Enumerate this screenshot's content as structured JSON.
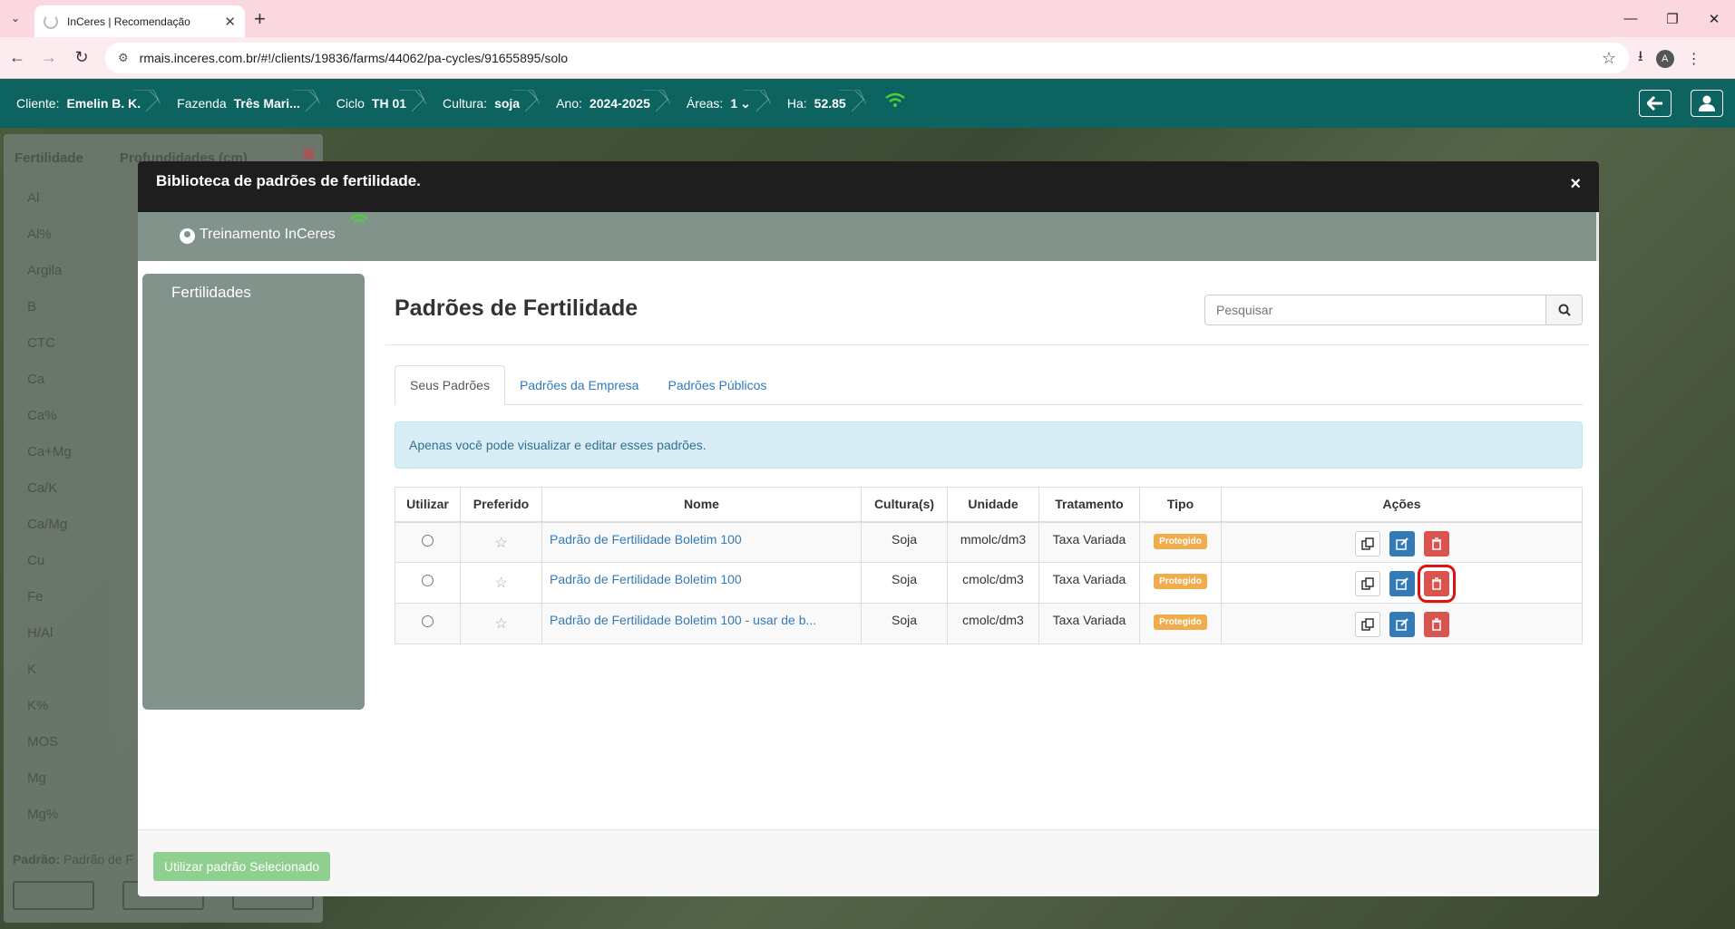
{
  "browser": {
    "tab_title": "InCeres | Recomendação",
    "url": "rmais.inceres.com.br/#!/clients/19836/farms/44062/pa-cycles/91655895/solo",
    "profile_initial": "A"
  },
  "header": {
    "crumbs": [
      {
        "label": "Cliente:",
        "value": "Emelin B. K."
      },
      {
        "label": "Fazenda",
        "value": "Três Mari..."
      },
      {
        "label": "Ciclo",
        "value": "TH 01"
      },
      {
        "label": "Cultura:",
        "value": "soja"
      },
      {
        "label": "Ano:",
        "value": "2024-2025"
      },
      {
        "label": "Áreas:",
        "value": "1"
      },
      {
        "label": "Ha:",
        "value": "52.85"
      }
    ],
    "areas_chevron": "⌄"
  },
  "background_panel": {
    "col1": "Fertilidade",
    "col2": "Profundidades (cm)",
    "rows": [
      "Al",
      "Al%",
      "Argila",
      "B",
      "CTC",
      "Ca",
      "Ca%",
      "Ca+Mg",
      "Ca/K",
      "Ca/Mg",
      "Cu",
      "Fe",
      "H/Al",
      "K",
      "K%",
      "MOS",
      "Mg",
      "Mg%"
    ],
    "footer_label": "Padrão:",
    "footer_value": "Padrão de F"
  },
  "modal": {
    "title": "Biblioteca de padrões de fertilidade.",
    "close": "×",
    "user_name": "Treinamento InCeres",
    "sidebar_items": [
      "Fertilidades"
    ],
    "page_title": "Padrões de Fertilidade",
    "search_placeholder": "Pesquisar",
    "tabs": [
      "Seus Padrões",
      "Padrões da Empresa",
      "Padrões Públicos"
    ],
    "alert": "Apenas você pode visualizar e editar esses padrões.",
    "columns": [
      "Utilizar",
      "Preferido",
      "Nome",
      "Cultura(s)",
      "Unidade",
      "Tratamento",
      "Tipo",
      "Ações"
    ],
    "rows": [
      {
        "name": "Padrão de Fertilidade Boletim 100",
        "culture": "Soja",
        "unit": "mmolc/dm3",
        "treatment": "Taxa Variada",
        "type": "Protegido"
      },
      {
        "name": "Padrão de Fertilidade Boletim 100",
        "culture": "Soja",
        "unit": "cmolc/dm3",
        "treatment": "Taxa Variada",
        "type": "Protegido"
      },
      {
        "name": "Padrão de Fertilidade Boletim 100 - usar de b...",
        "culture": "Soja",
        "unit": "cmolc/dm3",
        "treatment": "Taxa Variada",
        "type": "Protegido"
      }
    ],
    "footer_button": "Utilizar padrão Selecionado"
  },
  "colors": {
    "header_bg": "#0c6360",
    "modal_header_bg": "#1e1e1e",
    "sidebar_bg": "#81938a",
    "link": "#337ab7",
    "badge": "#f0ad4e",
    "delete": "#d9534f",
    "edit": "#337ab7",
    "use_button": "#8fcf8f"
  }
}
